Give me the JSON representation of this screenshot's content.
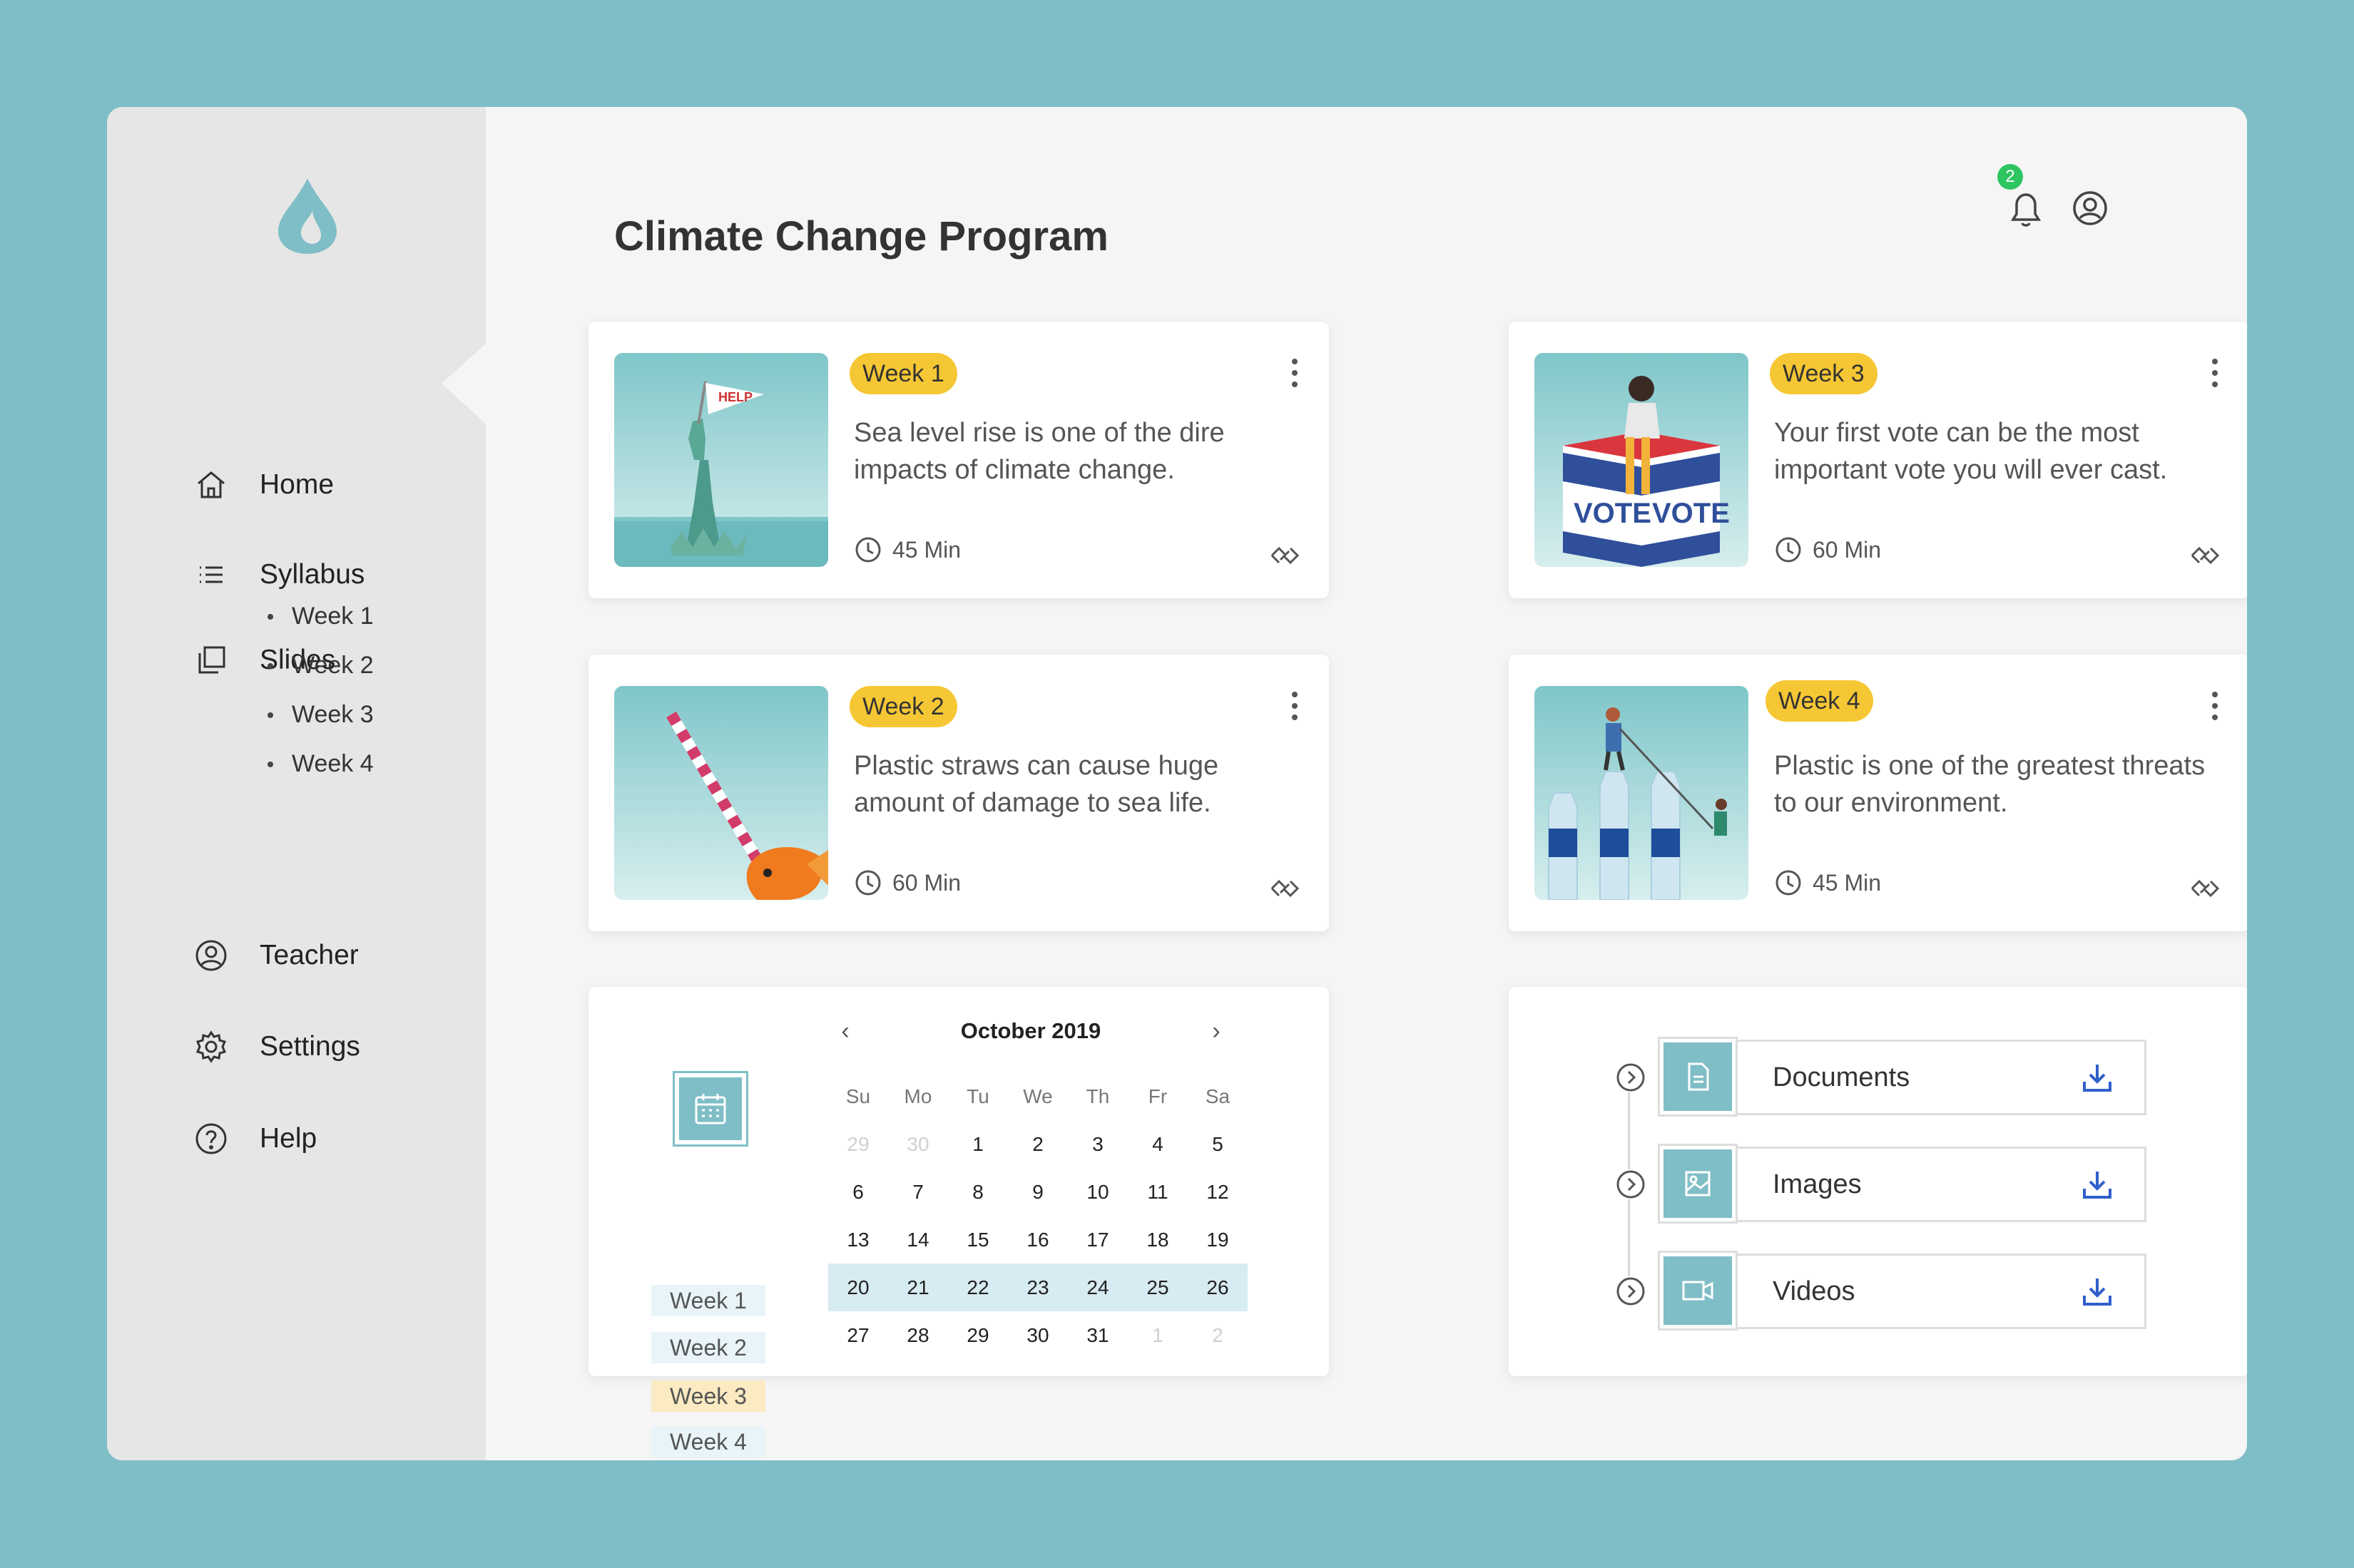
{
  "app": {
    "title": "Climate Change Program"
  },
  "colors": {
    "accent": "#7fbec7",
    "badge_yellow": "#f6c734",
    "notification_green": "#2ec561",
    "download_blue": "#2f5fcc"
  },
  "sidebar": {
    "logo": "droplet-logo-icon",
    "items": [
      {
        "label": "Home",
        "icon": "home-icon"
      },
      {
        "label": "Syllabus",
        "icon": "list-icon"
      },
      {
        "label": "Slides",
        "icon": "slides-icon"
      },
      {
        "label": "Teacher",
        "icon": "user-circle-icon"
      },
      {
        "label": "Settings",
        "icon": "gear-icon"
      },
      {
        "label": "Help",
        "icon": "help-icon"
      }
    ],
    "slides_subitems": [
      "Week 1",
      "Week 2",
      "Week 3",
      "Week 4"
    ]
  },
  "header": {
    "notification_count": "2"
  },
  "lessons": [
    {
      "week": "Week 1",
      "description": "Sea level rise is one of the dire impacts of climate change.",
      "duration": "45 Min",
      "image": "statue-of-liberty-help-flag"
    },
    {
      "week": "Week 3",
      "description": "Your first vote can be the most important vote you will ever cast.",
      "duration": "60 Min",
      "image": "woman-on-vote-box",
      "sign_text": "VOTE"
    },
    {
      "week": "Week 2",
      "description": "Plastic straws can cause huge amount of damage to sea life.",
      "duration": "60 Min",
      "image": "goldfish-with-straw"
    },
    {
      "week": "Week 4",
      "description": "Plastic is one of the greatest threats to our environment.",
      "duration": "45 Min",
      "image": "climbers-on-water-bottles"
    }
  ],
  "calendar": {
    "month": "October 2019",
    "prev": "‹",
    "next": "›",
    "weekdays": [
      "Su",
      "Mo",
      "Tu",
      "We",
      "Th",
      "Fr",
      "Sa"
    ],
    "weeks": [
      [
        "29",
        "30",
        "1",
        "2",
        "3",
        "4",
        "5"
      ],
      [
        "6",
        "7",
        "8",
        "9",
        "10",
        "11",
        "12"
      ],
      [
        "13",
        "14",
        "15",
        "16",
        "17",
        "18",
        "19"
      ],
      [
        "20",
        "21",
        "22",
        "23",
        "24",
        "25",
        "26"
      ],
      [
        "27",
        "28",
        "29",
        "30",
        "31",
        "1",
        "2"
      ]
    ],
    "highlighted_week": 3,
    "week_labels": [
      "Week 1",
      "Week 2",
      "Week 3",
      "Week 4"
    ],
    "active_week_label": "Week 3"
  },
  "resources": [
    {
      "label": "Documents",
      "icon": "document-icon"
    },
    {
      "label": "Images",
      "icon": "image-icon"
    },
    {
      "label": "Videos",
      "icon": "video-icon"
    }
  ]
}
